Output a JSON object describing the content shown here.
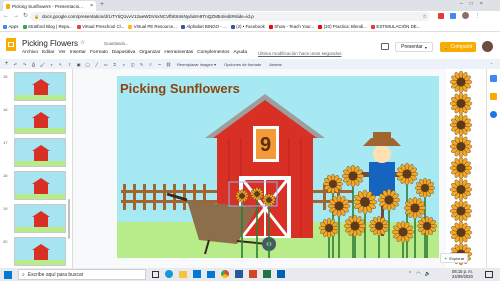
{
  "browser": {
    "tab_title": "Picking Sunflowers - Presentacio...",
    "new_tab": "+",
    "url": "docs.google.com/presentation/d/1iTYtiQ1vvV12aeWDVsxNCVfbE84sNydu8A9TnQZM54/edit#slide=id.p",
    "bookmarks": [
      {
        "label": "Apps",
        "color": "#4285f4"
      },
      {
        "label": "Stratford Blog | Repa...",
        "color": "#34a853"
      },
      {
        "label": "Virtual Preschool Cl...",
        "color": "#ea4335"
      },
      {
        "label": "Virtual PE Resource...",
        "color": "#fbbc05"
      },
      {
        "label": "Alphabet BINGO - ...",
        "color": "#3b5998"
      },
      {
        "label": "(2) • Facebook",
        "color": "#3b5998"
      },
      {
        "label": "Show - Teach Your...",
        "color": "#ff0000"
      },
      {
        "label": "(20) Practica: Blendi...",
        "color": "#ff0000"
      },
      {
        "label": "ESTIMULACIÓN DE...",
        "color": "#e53935"
      }
    ]
  },
  "app": {
    "doc_title": "Picking Flowers",
    "saving_text": "Guardando...",
    "menu": [
      "Archivo",
      "Editar",
      "Ver",
      "Insertar",
      "Formato",
      "Diapositiva",
      "Organizar",
      "Herramientas",
      "Complementos",
      "Ayuda"
    ],
    "last_edit": "Última modificación hace unos segundos",
    "present_label": "Presentar",
    "share_label": "Compartir",
    "toolbar_buttons": [
      "Reemplazar imagen ▾",
      "Opciones de formato",
      "Animar"
    ]
  },
  "filmstrip": {
    "slide_numbers": [
      "15",
      "16",
      "17",
      "18",
      "19",
      "20"
    ]
  },
  "slide": {
    "title": "Picking Sunflowers",
    "number_sign": "9"
  },
  "canvas": {
    "explore_label": "Explorar"
  },
  "taskbar": {
    "search_placeholder": "Escribe aquí para buscar",
    "time": "06:15 p. m.",
    "date": "24/09/2020"
  },
  "colors": {
    "share": "#f9ab00",
    "slide_bg": "#a7e9f3",
    "barn_red": "#d93025",
    "title": "#8b4513",
    "sunflower": "#f5a623"
  }
}
